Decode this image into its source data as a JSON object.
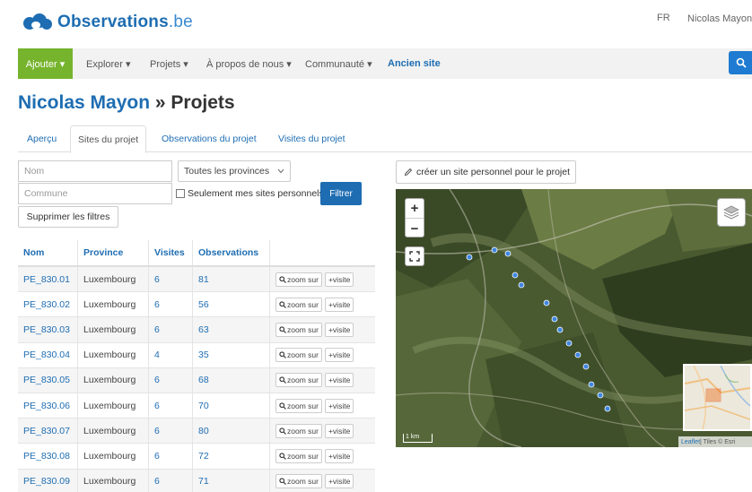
{
  "header": {
    "logo_bold": "Observations",
    "logo_light": ".be",
    "language": "FR",
    "user_menu": "Nicolas Mayon ▾"
  },
  "nav": {
    "add": "Ajouter ▾",
    "items": [
      "Explorer ▾",
      "Projets ▾",
      "À propos de nous ▾",
      "Communauté ▾"
    ],
    "old_site": "Ancien site",
    "search_icon": "search-icon"
  },
  "page": {
    "user": "Nicolas Mayon",
    "separator": " » ",
    "section": "Projets"
  },
  "tabs": [
    "Aperçu",
    "Sites du projet",
    "Observations du projet",
    "Visites du projet"
  ],
  "active_tab": "Sites du projet",
  "filters": {
    "name_placeholder": "Nom",
    "commune_placeholder": "Commune",
    "province_selected": "Toutes les provinces",
    "only_mine_label": "Seulement mes sites personnels",
    "filter_button": "Filtrer",
    "clear_button": "Supprimer les filtres"
  },
  "create_site_button": "créer un site personnel pour le projet",
  "table": {
    "headers": [
      "Nom",
      "Province",
      "Visites",
      "Observations"
    ],
    "zoom_label": "zoom sur",
    "visit_label": "+visite",
    "rows": [
      {
        "name": "PE_830.01",
        "province": "Luxembourg",
        "visits": "6",
        "observations": "81"
      },
      {
        "name": "PE_830.02",
        "province": "Luxembourg",
        "visits": "6",
        "observations": "56"
      },
      {
        "name": "PE_830.03",
        "province": "Luxembourg",
        "visits": "6",
        "observations": "63"
      },
      {
        "name": "PE_830.04",
        "province": "Luxembourg",
        "visits": "4",
        "observations": "35"
      },
      {
        "name": "PE_830.05",
        "province": "Luxembourg",
        "visits": "6",
        "observations": "68"
      },
      {
        "name": "PE_830.06",
        "province": "Luxembourg",
        "visits": "6",
        "observations": "70"
      },
      {
        "name": "PE_830.07",
        "province": "Luxembourg",
        "visits": "6",
        "observations": "80"
      },
      {
        "name": "PE_830.08",
        "province": "Luxembourg",
        "visits": "6",
        "observations": "72"
      },
      {
        "name": "PE_830.09",
        "province": "Luxembourg",
        "visits": "6",
        "observations": "71"
      }
    ]
  },
  "map": {
    "zoom_in": "+",
    "zoom_out": "−",
    "scale_label": "1 km",
    "attribution_link": "Leaflet",
    "attribution_text": " | Tiles © Esri"
  },
  "colors": {
    "brand_blue": "#1e6db2",
    "add_green": "#76b42d",
    "marker_blue": "#3f86e0"
  }
}
